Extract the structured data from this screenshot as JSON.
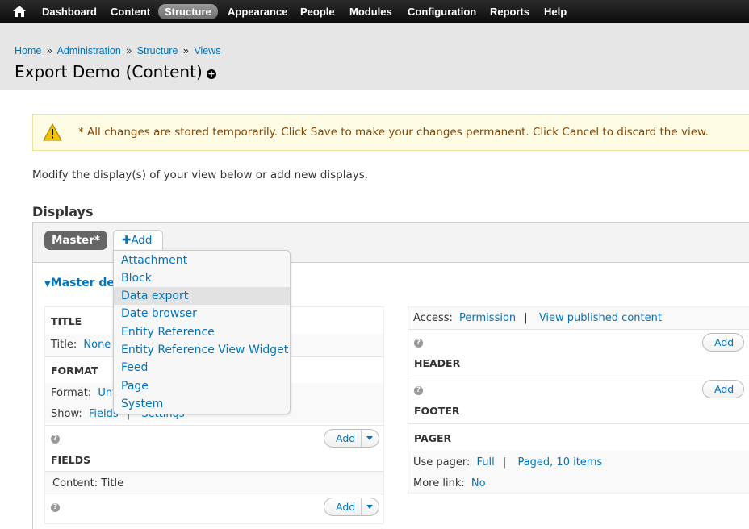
{
  "toolbar": {
    "menu": [
      "Dashboard",
      "Content",
      "Structure",
      "Appearance",
      "People",
      "Modules",
      "Configuration",
      "Reports",
      "Help"
    ],
    "active": "Structure"
  },
  "breadcrumb": [
    "Home",
    "Administration",
    "Structure",
    "Views"
  ],
  "breadcrumb_sep": "»",
  "page_title": "Export Demo (Content)",
  "warning": "* All changes are stored temporarily. Click Save to make your changes permanent. Click Cancel to discard the view.",
  "intro": "Modify the display(s) of your view below or add new displays.",
  "displays_title": "Displays",
  "tabs": {
    "master": "Master*",
    "add": "Add"
  },
  "master_details": "Master de",
  "dropdown": [
    "Attachment",
    "Block",
    "Data export",
    "Date browser",
    "Entity Reference",
    "Entity Reference View Widget",
    "Feed",
    "Page",
    "System"
  ],
  "dropdown_hover": "Data export",
  "left": {
    "title_head": "TITLE",
    "title_label": "Title:",
    "title_value": "None",
    "format_head": "FORMAT",
    "format_label": "Format:",
    "format_value": "Unf",
    "show_label": "Show:",
    "show_fields": "Fields",
    "show_sep": "|",
    "show_settings": "Settings",
    "fields_head": "FIELDS",
    "fields_value": "Content: Title",
    "add": "Add",
    "help": "?"
  },
  "right": {
    "access_label": "Access:",
    "access_perm": "Permission",
    "access_sep": "|",
    "access_value": "View published content",
    "header_head": "HEADER",
    "footer_head": "FOOTER",
    "pager_head": "PAGER",
    "pager_label": "Use pager:",
    "pager_full": "Full",
    "pager_sep": "|",
    "pager_paged": "Paged, 10 items",
    "more_label": "More link:",
    "more_value": "No",
    "add": "Add",
    "help": "?"
  },
  "colors": {
    "link": "#0074bd",
    "warning_bg": "#fffce5",
    "warning_text": "#884400",
    "header_bg": "#e6e6e6"
  },
  "icons": {
    "home": "home-icon",
    "warning": "warning-icon",
    "shortcut": "add-shortcut-icon",
    "help": "help-icon",
    "caret": "caret-down-icon"
  }
}
